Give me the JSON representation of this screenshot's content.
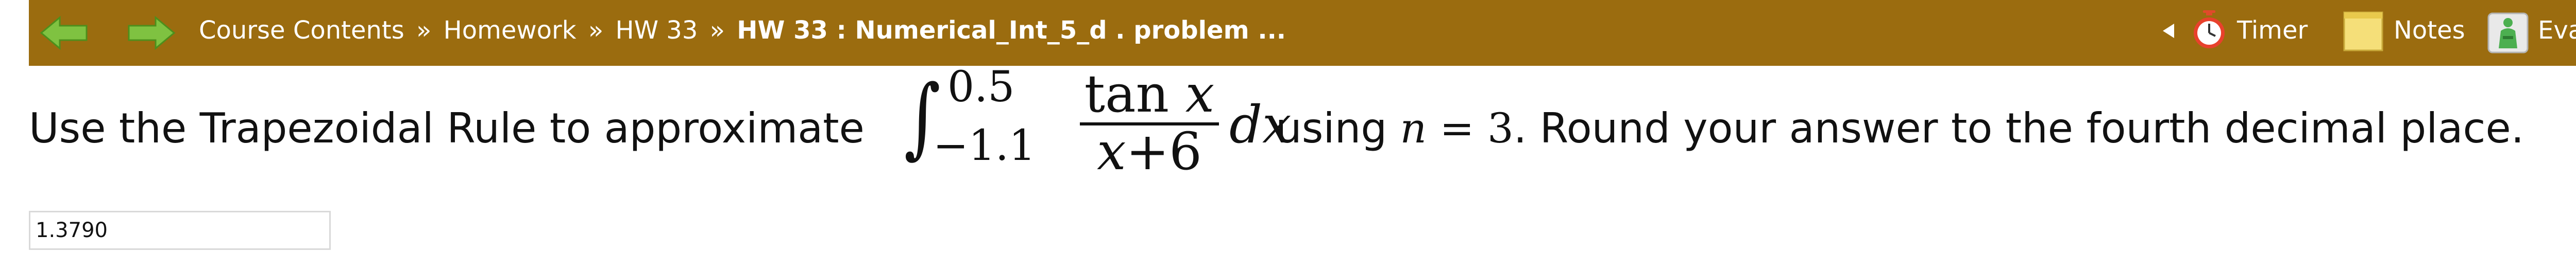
{
  "toolbar": {
    "background_color": "#9b6c0f",
    "back_icon": "back-arrow-icon",
    "forward_icon": "forward-arrow-icon",
    "breadcrumb": {
      "items": [
        "Course Contents",
        "Homework",
        "HW 33"
      ],
      "separator": "»",
      "current": "HW 33 : Numerical_Int_5_d . problem ..."
    },
    "tools": {
      "timer_label": "Timer",
      "notes_label": "Notes",
      "evaluate_label": "Evaluate"
    }
  },
  "problem": {
    "text_before": "Use the Trapezoidal Rule to approximate",
    "integral": {
      "upper_limit": "0.5",
      "lower_limit": "−1.1",
      "numerator_func": "tan",
      "numerator_var": "x",
      "denominator_var": "x",
      "denominator_rest": "+6",
      "differential": "dx"
    },
    "text_using": "using",
    "n_var": "n",
    "equals": "=",
    "n_value": "3",
    "text_after": ". Round your answer to the fourth decimal place."
  },
  "answer": {
    "value": "1.3790"
  }
}
